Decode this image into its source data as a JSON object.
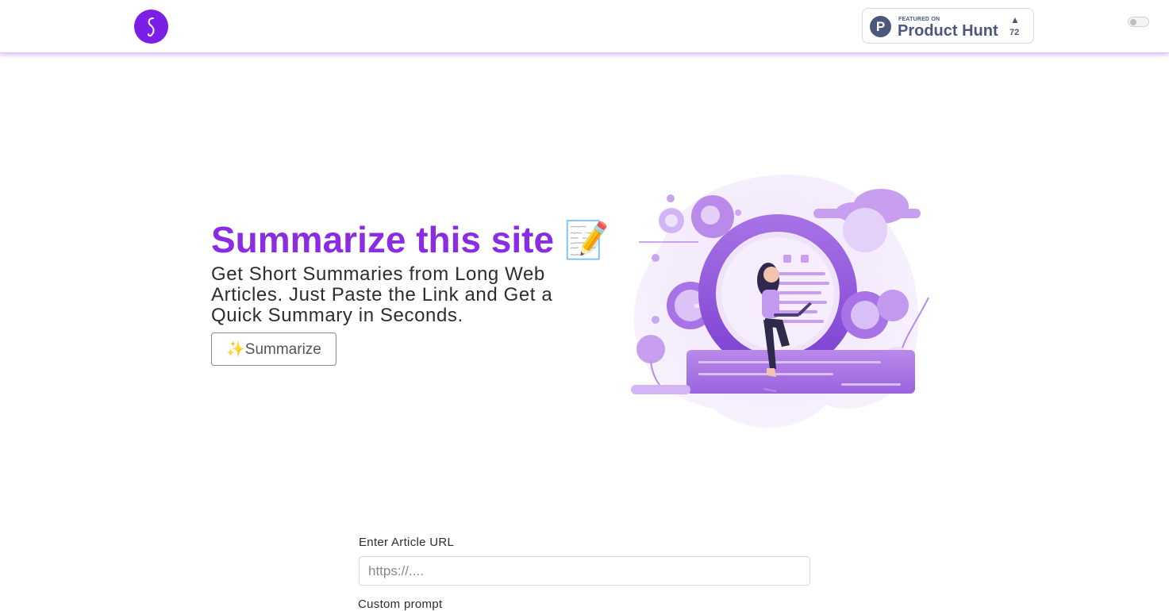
{
  "header": {
    "logo_icon": "s-logo-icon",
    "brand_color": "#7c1fe6",
    "product_hunt": {
      "featured_label": "FEATURED ON",
      "name": "Product Hunt",
      "logo_letter": "P",
      "upvote_arrow": "▲",
      "upvotes": "72"
    },
    "theme_toggle_icon": "toggle-switch-icon"
  },
  "hero": {
    "title": "Summarize this site 📝",
    "subtitle": "Get Short Summaries from Long Web Articles. Just Paste the Link and Get a Quick Summary in Seconds.",
    "cta_label": "✨Summarize",
    "title_color": "#8b2be2",
    "illustration_icon": "woman-with-laptop-illustration"
  },
  "form": {
    "url_label": "Enter Article URL",
    "url_placeholder": "https://....",
    "url_value": "",
    "prompt_label": "Custom prompt"
  }
}
